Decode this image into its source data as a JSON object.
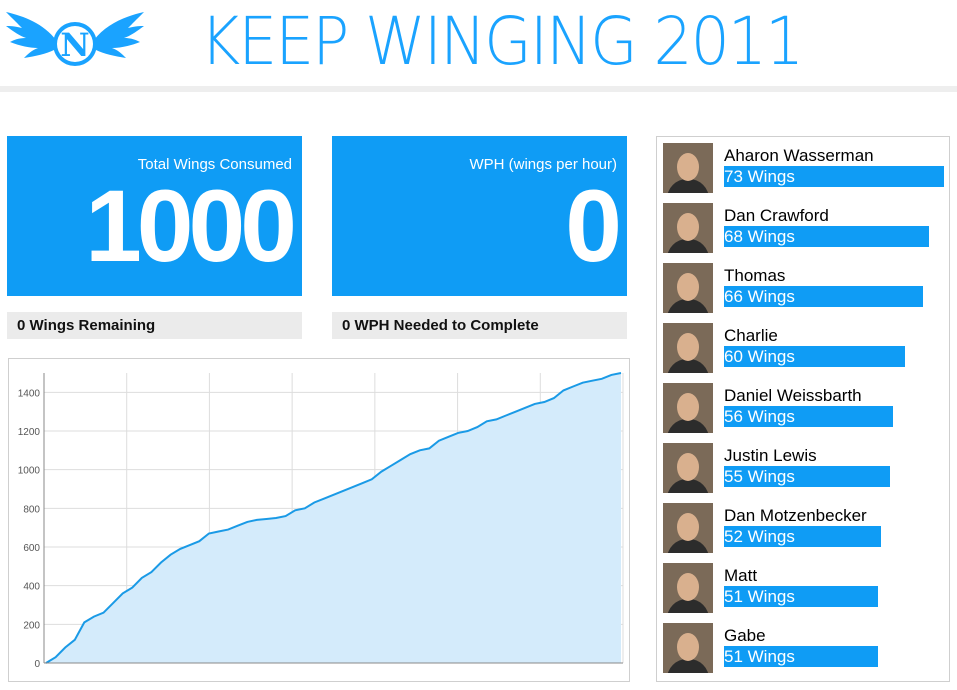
{
  "header": {
    "logo_letter": "N",
    "title": "KEEP WINGING 2011"
  },
  "colors": {
    "accent": "#0f9cf5",
    "title": "#1aa3ff",
    "chart_fill": "#d4ebfb",
    "chart_line": "#1a9ae6",
    "sub_box": "#ebebeb"
  },
  "stats": {
    "total": {
      "label": "Total Wings Consumed",
      "value": "1000"
    },
    "wph": {
      "label": "WPH (wings per hour)",
      "value": "0"
    }
  },
  "subs": {
    "remaining": "0 Wings Remaining",
    "needed": "0 WPH Needed to Complete"
  },
  "chart_data": {
    "type": "area",
    "y_ticks": [
      "0",
      "200",
      "400",
      "600",
      "800",
      "1000",
      "1200",
      "1400"
    ],
    "ylim": [
      0,
      1500
    ],
    "grid": true,
    "values": [
      0,
      30,
      80,
      120,
      210,
      240,
      260,
      310,
      360,
      390,
      440,
      470,
      520,
      560,
      590,
      610,
      630,
      670,
      680,
      690,
      710,
      730,
      740,
      745,
      750,
      760,
      790,
      800,
      830,
      850,
      870,
      890,
      910,
      930,
      950,
      990,
      1020,
      1050,
      1080,
      1100,
      1110,
      1150,
      1170,
      1190,
      1200,
      1220,
      1250,
      1260,
      1280,
      1300,
      1320,
      1340,
      1350,
      1370,
      1410,
      1430,
      1450,
      1460,
      1470,
      1490,
      1500
    ]
  },
  "leaderboard": {
    "max_wings": 73,
    "entries": [
      {
        "name": "Aharon Wasserman",
        "wings": 73,
        "label": "73 Wings"
      },
      {
        "name": "Dan Crawford",
        "wings": 68,
        "label": "68 Wings"
      },
      {
        "name": "Thomas",
        "wings": 66,
        "label": "66 Wings"
      },
      {
        "name": "Charlie",
        "wings": 60,
        "label": "60 Wings"
      },
      {
        "name": "Daniel Weissbarth",
        "wings": 56,
        "label": "56 Wings"
      },
      {
        "name": "Justin Lewis",
        "wings": 55,
        "label": "55 Wings"
      },
      {
        "name": "Dan Motzenbecker",
        "wings": 52,
        "label": "52 Wings"
      },
      {
        "name": "Matt",
        "wings": 51,
        "label": "51 Wings"
      },
      {
        "name": "Gabe",
        "wings": 51,
        "label": "51 Wings"
      }
    ]
  }
}
